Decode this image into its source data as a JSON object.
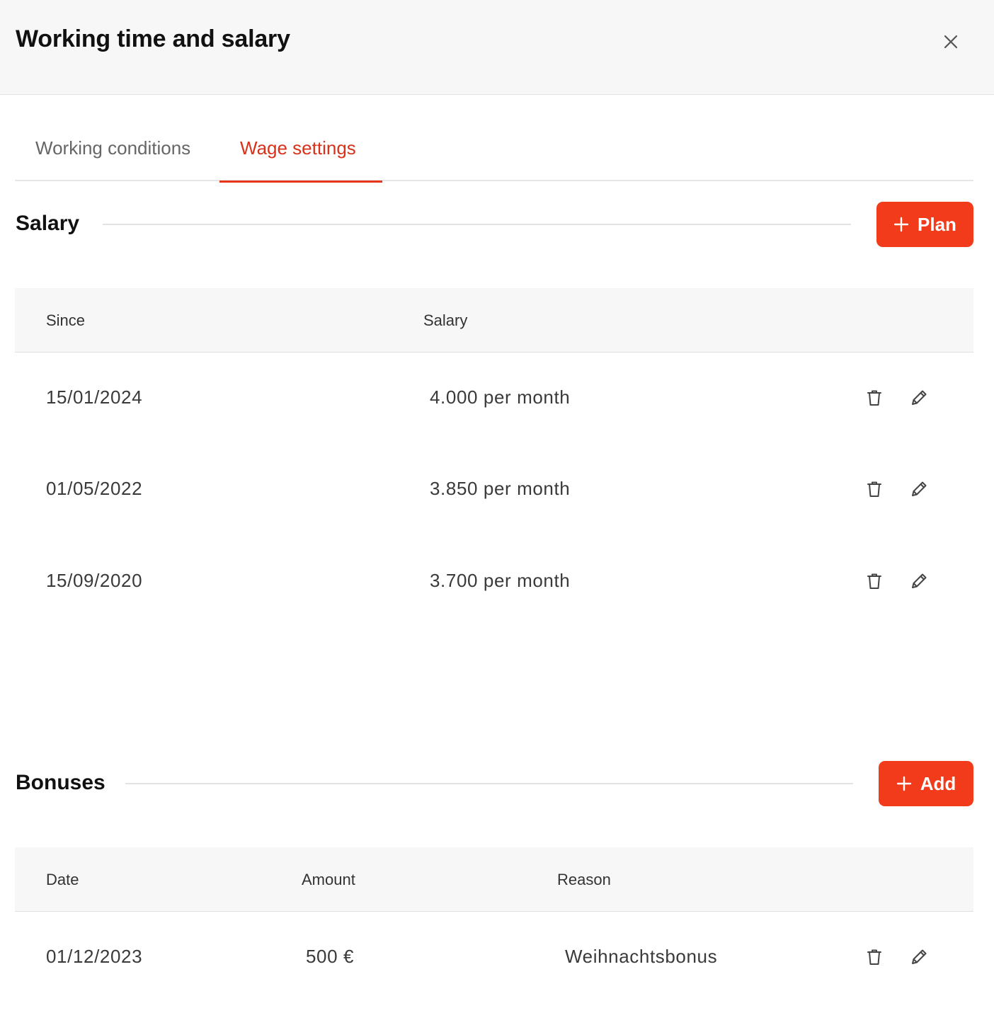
{
  "header": {
    "title": "Working time and salary",
    "close_icon": "close-icon"
  },
  "tabs": [
    {
      "label": "Working conditions",
      "active": false
    },
    {
      "label": "Wage settings",
      "active": true
    }
  ],
  "colors": {
    "accent": "#f23b1a",
    "active_tab_text": "#d8321b",
    "header_bg": "#f7f7f7"
  },
  "salary": {
    "title": "Salary",
    "button_label": "Plan",
    "columns": [
      "Since",
      "Salary"
    ],
    "rows": [
      {
        "since": "15/01/2024",
        "salary": "4.000 per month"
      },
      {
        "since": "01/05/2022",
        "salary": "3.850 per month"
      },
      {
        "since": "15/09/2020",
        "salary": "3.700 per month"
      }
    ]
  },
  "bonuses": {
    "title": "Bonuses",
    "button_label": "Add",
    "columns": [
      "Date",
      "Amount",
      "Reason"
    ],
    "rows": [
      {
        "date": "01/12/2023",
        "amount": "500 €",
        "reason": "Weihnachtsbonus"
      }
    ]
  },
  "row_icons": [
    "trash-icon",
    "pencil-icon"
  ]
}
